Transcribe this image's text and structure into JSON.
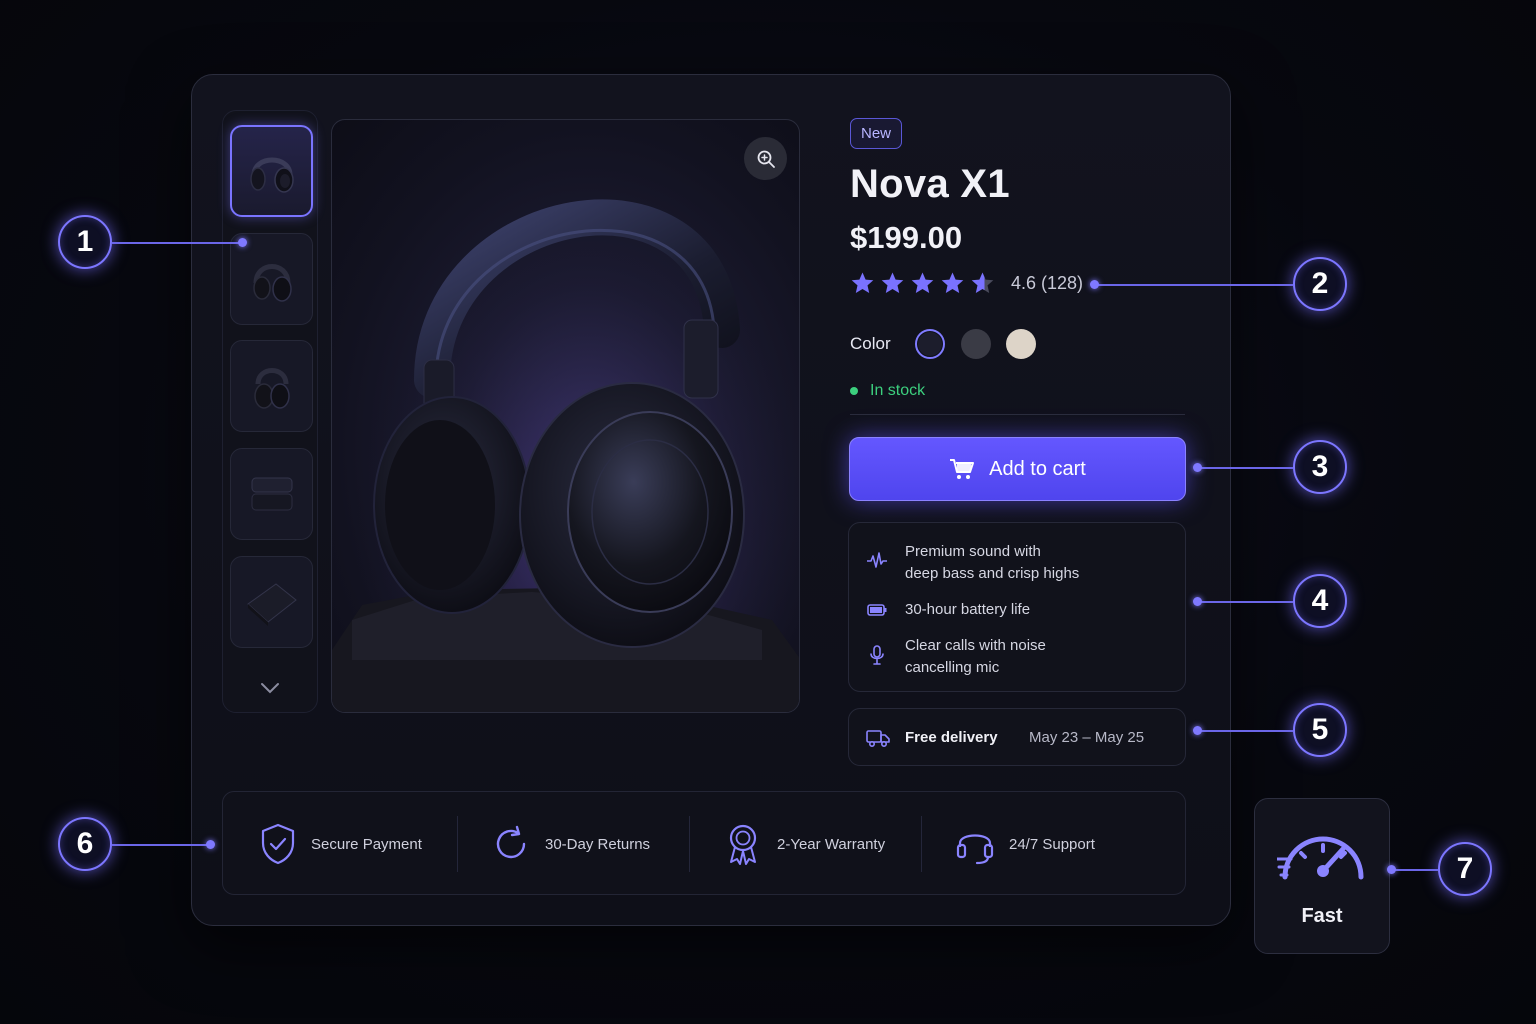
{
  "product": {
    "badge": "New",
    "title": "Nova X1",
    "price": "$199.00",
    "rating_value": 4.6,
    "rating_text": "4.6 (128)",
    "stars_filled": 4,
    "color_label": "Color",
    "colors": [
      "#1c1d2c",
      "#3a3b45",
      "#ddd4c8"
    ],
    "selected_color_index": 0,
    "stock_text": "In stock"
  },
  "gallery": {
    "thumbnail_count": 5,
    "active_index": 0,
    "thumbnails": [
      "headphones-front",
      "headphones-side",
      "headphones-folded",
      "carrying-case-stack",
      "carrying-case"
    ]
  },
  "cart": {
    "label": "Add to cart"
  },
  "features": [
    {
      "icon": "waveform-icon",
      "text_line1": "Premium sound with",
      "text_line2": "deep bass and crisp highs"
    },
    {
      "icon": "battery-icon",
      "text_line1": "30-hour battery life",
      "text_line2": ""
    },
    {
      "icon": "microphone-icon",
      "text_line1": "Clear calls with noise",
      "text_line2": "cancelling mic"
    }
  ],
  "delivery": {
    "label": "Free delivery",
    "date": "May 23 – May 25"
  },
  "trust": [
    {
      "icon": "shield-check-icon",
      "label": "Secure Payment"
    },
    {
      "icon": "refresh-icon",
      "label": "30-Day Returns"
    },
    {
      "icon": "award-ribbon-icon",
      "label": "2-Year Warranty"
    },
    {
      "icon": "headset-icon",
      "label": "24/7 Support"
    }
  ],
  "fast": {
    "label": "Fast"
  },
  "callouts": [
    "1",
    "2",
    "3",
    "4",
    "5",
    "6",
    "7"
  ],
  "colors": {
    "accent": "#6457ff",
    "stock_green": "#3ccf7e",
    "background": "#07080f"
  }
}
